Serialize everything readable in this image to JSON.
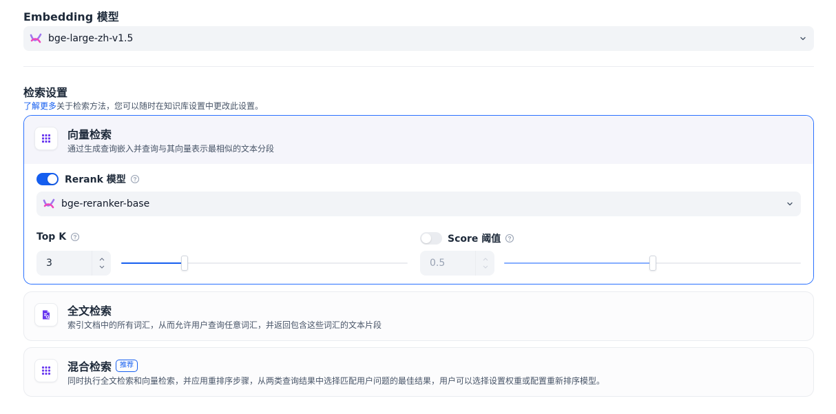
{
  "embedding": {
    "title": "Embedding 模型",
    "selected_model": "bge-large-zh-v1.5"
  },
  "retrieval": {
    "title": "检索设置",
    "learn_more": "了解更多",
    "description": "关于检索方法，您可以随时在知识库设置中更改此设置。"
  },
  "vector": {
    "title": "向量检索",
    "description": "通过生成查询嵌入并查询与其向量表示最相似的文本分段",
    "rerank_label": "Rerank 模型",
    "rerank_enabled": true,
    "rerank_model": "bge-reranker-base",
    "topk_label": "Top K",
    "topk_value": "3",
    "topk_fraction": 0.22,
    "score_label": "Score 阈值",
    "score_enabled": false,
    "score_value": "0.5",
    "score_fraction": 0.5
  },
  "fulltext": {
    "title": "全文检索",
    "description": "索引文档中的所有词汇，从而允许用户查询任意词汇，并返回包含这些词汇的文本片段"
  },
  "hybrid": {
    "title": "混合检索",
    "badge": "推荐",
    "description": "同时执行全文检索和向量检索，并应用重排序步骤，从两类查询结果中选择匹配用户问题的最佳结果，用户可以选择设置权重或配置重新排序模型。"
  },
  "icons": {
    "model": "model-logo-icon",
    "chevron": "chevron-down-icon",
    "vector": "dots-grid-icon",
    "fulltext": "document-search-icon",
    "hybrid": "dots-grid-icon",
    "help": "help-circle-icon"
  },
  "colors": {
    "accent": "#155eef",
    "icon_purple": "#6938ef"
  }
}
